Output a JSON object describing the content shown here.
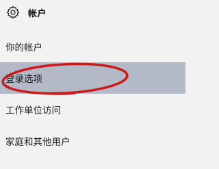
{
  "header": {
    "icon": "gear-icon",
    "title": "帐户"
  },
  "nav": {
    "items": [
      {
        "label": "你的帐户",
        "selected": false
      },
      {
        "label": "登录选项",
        "selected": true
      },
      {
        "label": "工作单位访问",
        "selected": false
      },
      {
        "label": "家庭和其他用户",
        "selected": false
      }
    ]
  },
  "colors": {
    "background": "#f2f2f2",
    "selected_background": "#b4b9c7",
    "annotation_circle": "#cc1a1a"
  }
}
